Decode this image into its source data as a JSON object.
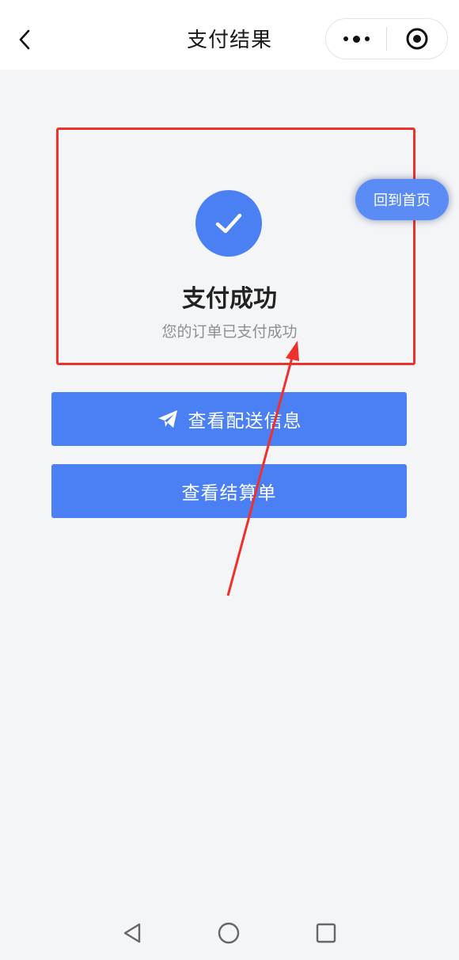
{
  "navbar": {
    "title": "支付结果",
    "back_icon": "chevron-left-icon",
    "more_icon": "more-dots-icon",
    "close_icon": "target-close-icon"
  },
  "result": {
    "status_icon": "check-circle-icon",
    "title": "支付成功",
    "description": "您的订单已支付成功"
  },
  "floating": {
    "home_label": "回到首页"
  },
  "actions": {
    "delivery_label": "查看配送信息",
    "delivery_icon": "paper-plane-icon",
    "settlement_label": "查看结算单"
  },
  "system_nav": {
    "back_icon": "triangle-back-icon",
    "home_icon": "circle-home-icon",
    "recent_icon": "square-recent-icon"
  },
  "colors": {
    "accent": "#4b80f5",
    "annotation": "#f0302a",
    "background": "#f4f5f7"
  }
}
